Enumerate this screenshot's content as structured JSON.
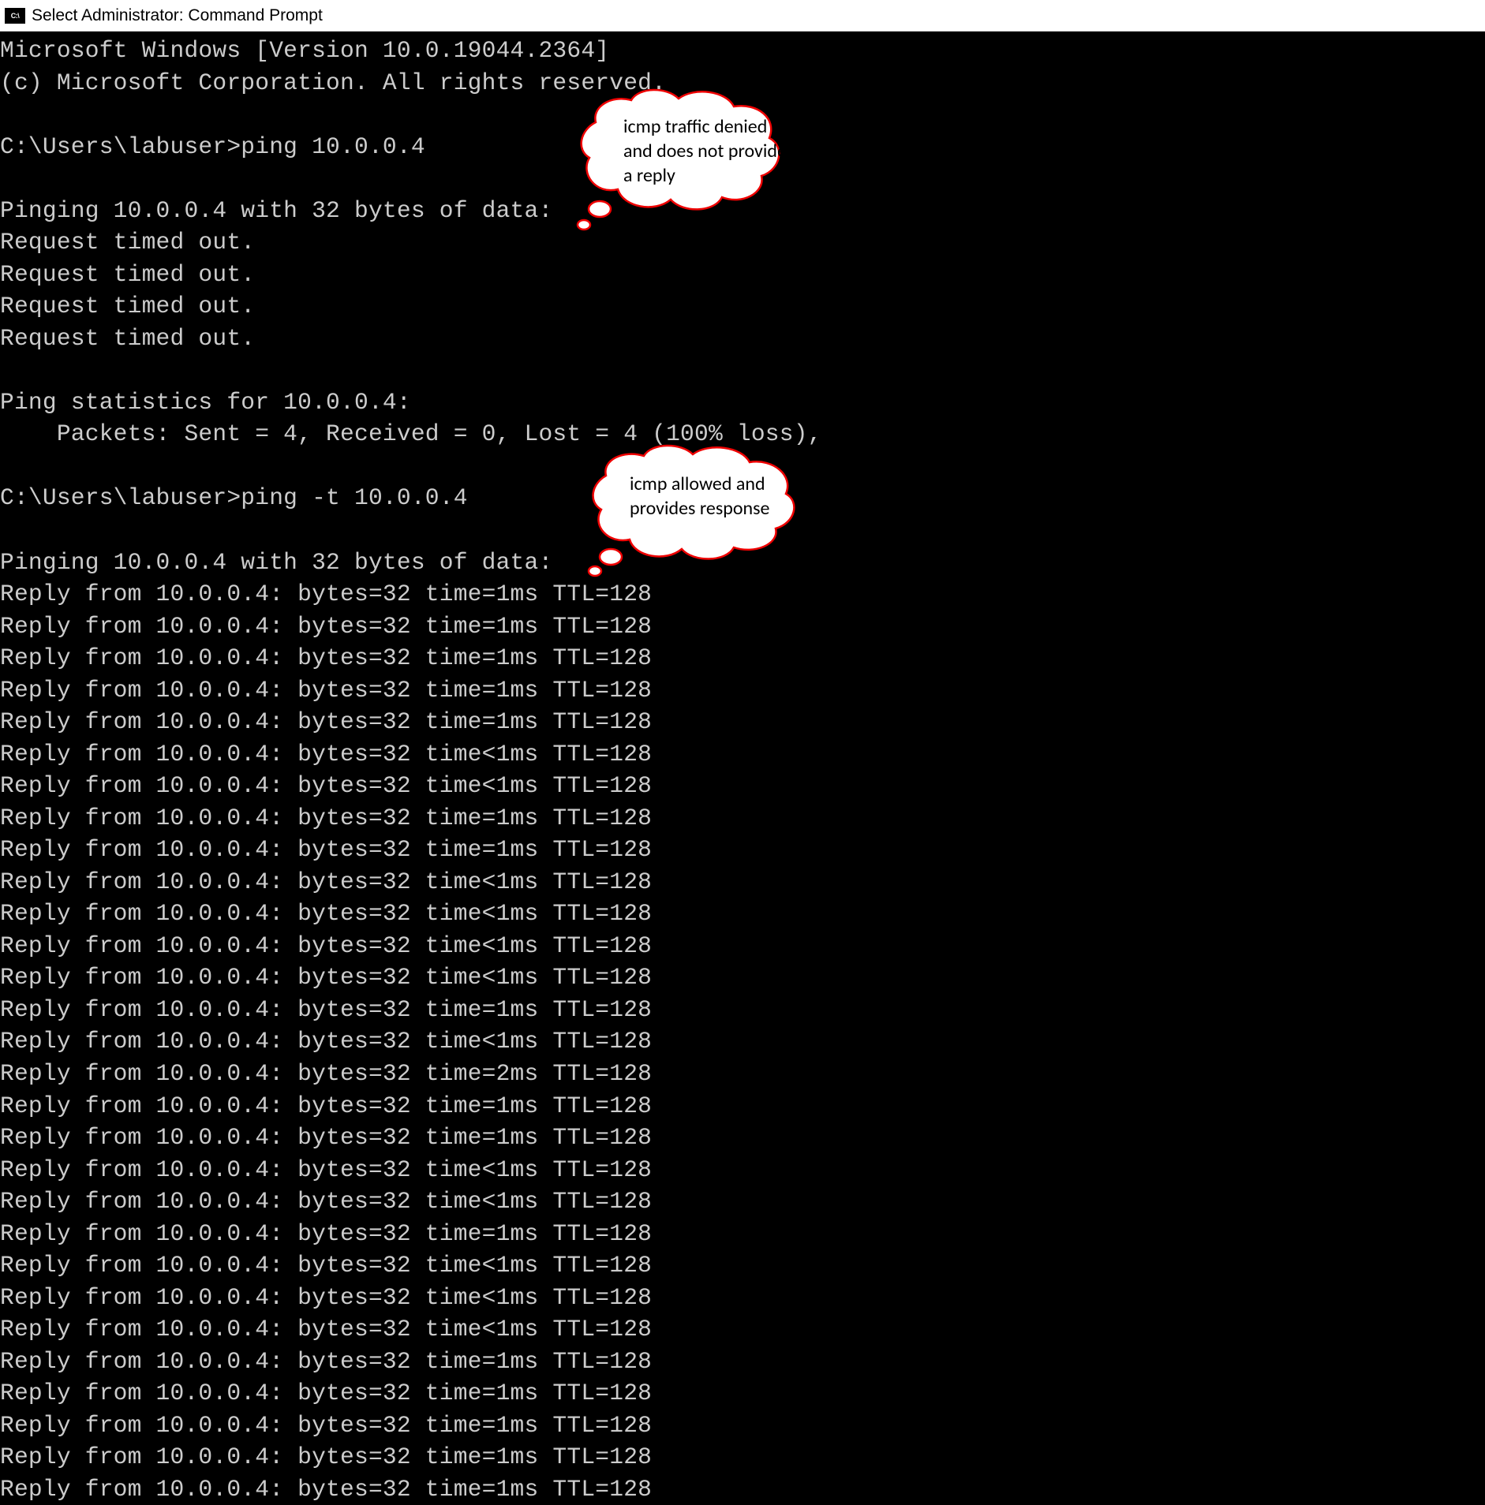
{
  "window": {
    "icon_label": "C:\\",
    "title": "Select Administrator: Command Prompt"
  },
  "terminal": {
    "lines": [
      "Microsoft Windows [Version 10.0.19044.2364]",
      "(c) Microsoft Corporation. All rights reserved.",
      "",
      "C:\\Users\\labuser>ping 10.0.0.4",
      "",
      "Pinging 10.0.0.4 with 32 bytes of data:",
      "Request timed out.",
      "Request timed out.",
      "Request timed out.",
      "Request timed out.",
      "",
      "Ping statistics for 10.0.0.4:",
      "    Packets: Sent = 4, Received = 0, Lost = 4 (100% loss),",
      "",
      "C:\\Users\\labuser>ping -t 10.0.0.4",
      "",
      "Pinging 10.0.0.4 with 32 bytes of data:",
      "Reply from 10.0.0.4: bytes=32 time=1ms TTL=128",
      "Reply from 10.0.0.4: bytes=32 time=1ms TTL=128",
      "Reply from 10.0.0.4: bytes=32 time=1ms TTL=128",
      "Reply from 10.0.0.4: bytes=32 time=1ms TTL=128",
      "Reply from 10.0.0.4: bytes=32 time=1ms TTL=128",
      "Reply from 10.0.0.4: bytes=32 time<1ms TTL=128",
      "Reply from 10.0.0.4: bytes=32 time<1ms TTL=128",
      "Reply from 10.0.0.4: bytes=32 time=1ms TTL=128",
      "Reply from 10.0.0.4: bytes=32 time=1ms TTL=128",
      "Reply from 10.0.0.4: bytes=32 time<1ms TTL=128",
      "Reply from 10.0.0.4: bytes=32 time<1ms TTL=128",
      "Reply from 10.0.0.4: bytes=32 time<1ms TTL=128",
      "Reply from 10.0.0.4: bytes=32 time<1ms TTL=128",
      "Reply from 10.0.0.4: bytes=32 time=1ms TTL=128",
      "Reply from 10.0.0.4: bytes=32 time<1ms TTL=128",
      "Reply from 10.0.0.4: bytes=32 time=2ms TTL=128",
      "Reply from 10.0.0.4: bytes=32 time=1ms TTL=128",
      "Reply from 10.0.0.4: bytes=32 time=1ms TTL=128",
      "Reply from 10.0.0.4: bytes=32 time<1ms TTL=128",
      "Reply from 10.0.0.4: bytes=32 time<1ms TTL=128",
      "Reply from 10.0.0.4: bytes=32 time=1ms TTL=128",
      "Reply from 10.0.0.4: bytes=32 time<1ms TTL=128",
      "Reply from 10.0.0.4: bytes=32 time<1ms TTL=128",
      "Reply from 10.0.0.4: bytes=32 time<1ms TTL=128",
      "Reply from 10.0.0.4: bytes=32 time=1ms TTL=128",
      "Reply from 10.0.0.4: bytes=32 time=1ms TTL=128",
      "Reply from 10.0.0.4: bytes=32 time=1ms TTL=128",
      "Reply from 10.0.0.4: bytes=32 time=1ms TTL=128",
      "Reply from 10.0.0.4: bytes=32 time=1ms TTL=128"
    ]
  },
  "callouts": {
    "denied": {
      "text": "icmp traffic denied and does not provide a reply"
    },
    "allowed": {
      "text": "icmp allowed and provides response"
    }
  }
}
